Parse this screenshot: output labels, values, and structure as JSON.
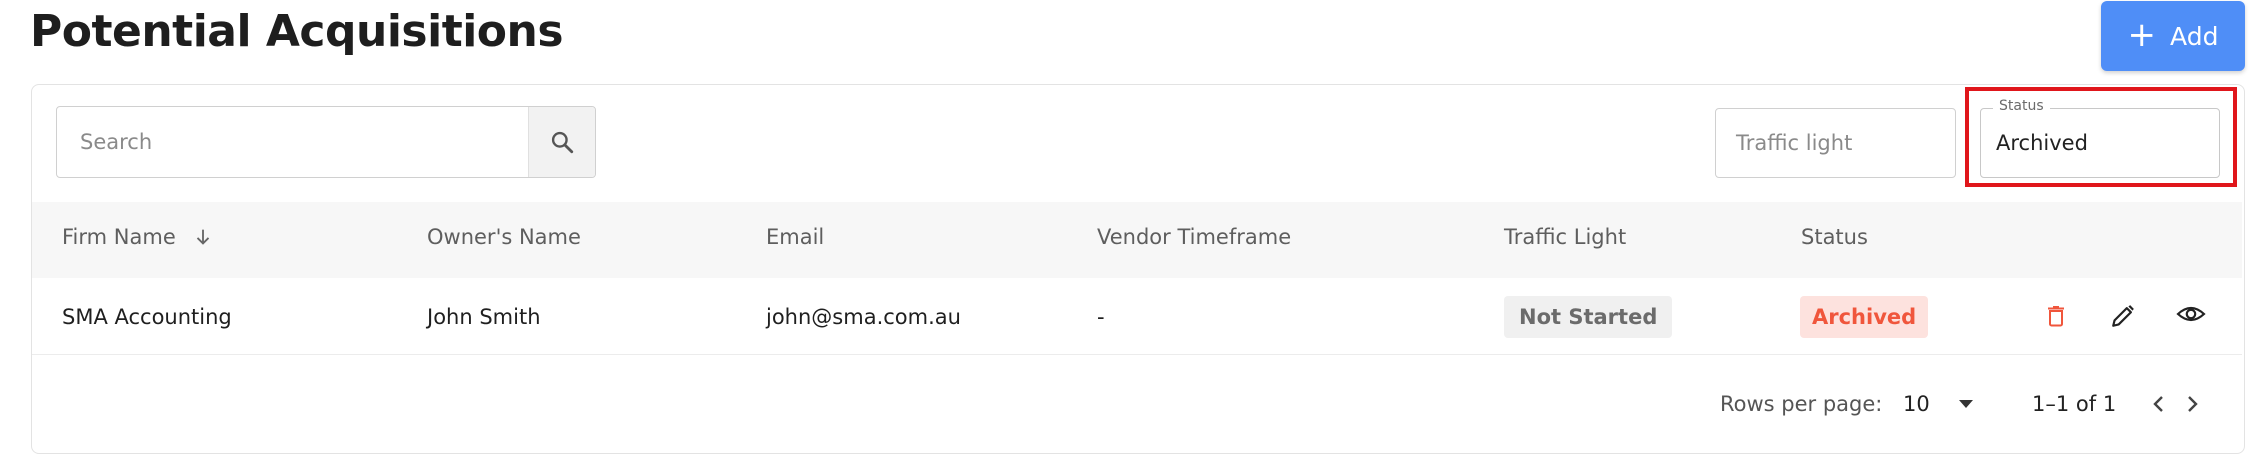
{
  "page": {
    "title": "Potential Acquisitions"
  },
  "header": {
    "add_label": "Add",
    "add_icon": "plus-icon"
  },
  "filters": {
    "search_placeholder": "Search",
    "search_icon": "search-icon",
    "traffic_light_placeholder": "Traffic light",
    "status_label": "Status",
    "status_value": "Archived"
  },
  "table": {
    "columns": [
      "Firm Name",
      "Owner's Name",
      "Email",
      "Vendor Timeframe",
      "Traffic Light",
      "Status"
    ],
    "sort_icon": "arrow-down-icon",
    "rows": [
      {
        "firm_name": "SMA Accounting",
        "owner_name": "John Smith",
        "email": "john@sma.com.au",
        "vendor_timeframe": "-",
        "traffic_light": "Not Started",
        "status": "Archived",
        "actions": [
          "trash-icon",
          "pencil-icon",
          "eye-icon"
        ]
      }
    ]
  },
  "pagination": {
    "rows_per_page_label": "Rows per page:",
    "rows_per_page_value": "10",
    "range": "1–1 of 1"
  },
  "colors": {
    "primary": "#4f8ef7",
    "highlight": "#e0161b",
    "archived_text": "#f0563c",
    "archived_bg": "#fde2de",
    "delete_icon": "#f0563c"
  }
}
